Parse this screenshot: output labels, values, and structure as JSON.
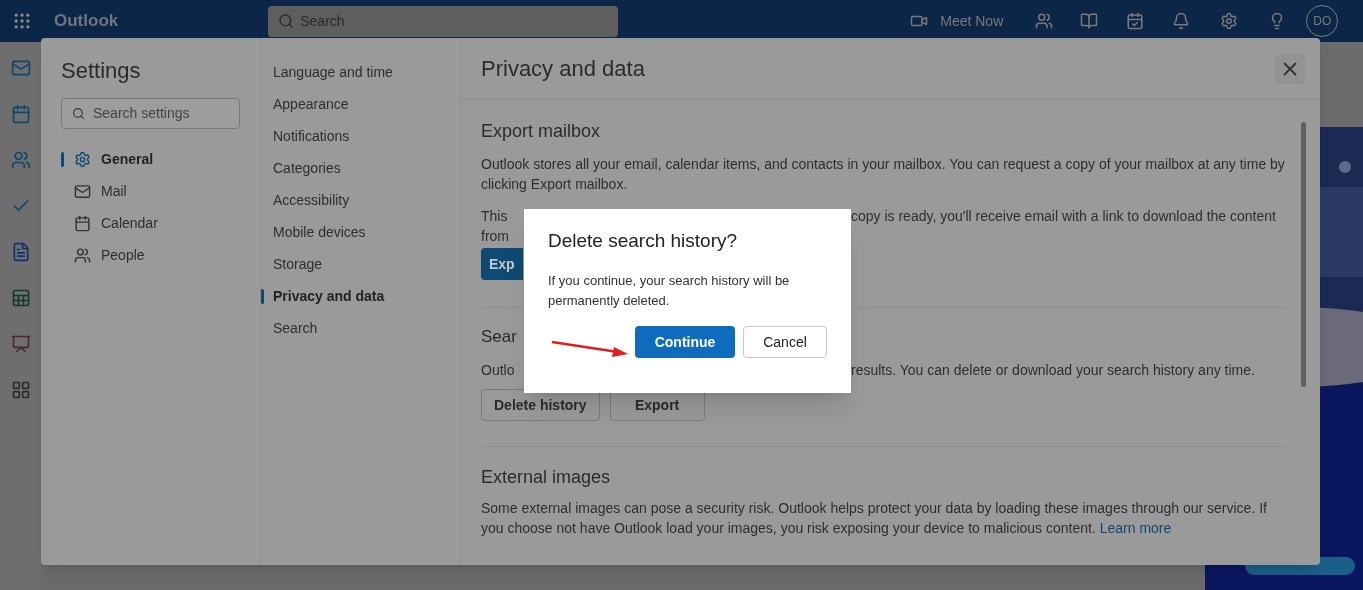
{
  "top_bar": {
    "app_name": "Outlook",
    "search_placeholder": "Search",
    "meet_now": "Meet Now",
    "avatar": "DO"
  },
  "settings": {
    "title": "Settings",
    "search_placeholder": "Search settings",
    "categories": [
      {
        "label": "General",
        "selected": true
      },
      {
        "label": "Mail",
        "selected": false
      },
      {
        "label": "Calendar",
        "selected": false
      },
      {
        "label": "People",
        "selected": false
      }
    ],
    "subsections": [
      {
        "label": "Language and time",
        "selected": false
      },
      {
        "label": "Appearance",
        "selected": false
      },
      {
        "label": "Notifications",
        "selected": false
      },
      {
        "label": "Categories",
        "selected": false
      },
      {
        "label": "Accessibility",
        "selected": false
      },
      {
        "label": "Mobile devices",
        "selected": false
      },
      {
        "label": "Storage",
        "selected": false
      },
      {
        "label": "Privacy and data",
        "selected": true
      },
      {
        "label": "Search",
        "selected": false
      }
    ],
    "page_title": "Privacy and data",
    "export_mailbox": {
      "heading": "Export mailbox",
      "text": "Outlook stores all your email, calendar items, and contacts in your mailbox. You can request a copy of your mailbox at any time by clicking Export mailbox.",
      "line_start": "This",
      "line_end": "copy is ready, you'll receive email with a link to download the content",
      "line_2": "from",
      "button": "Exp"
    },
    "search_history": {
      "heading": "Sear",
      "line_start": "Outlo",
      "line_end": "results. You can delete or download your search history any time.",
      "buttons": [
        "Delete history",
        "Export"
      ]
    },
    "external_images": {
      "heading": "External images",
      "text": "Some external images can pose a security risk. Outlook helps protect your data by loading these images through our service. If you choose not have Outlook load your images, you risk exposing your device to malicious content.",
      "link": "Learn more"
    }
  },
  "dialog": {
    "title": "Delete search history?",
    "text": "If you continue, your search history will be permanently deleted.",
    "buttons": [
      {
        "label": "Continue",
        "primary": true
      },
      {
        "label": "Cancel",
        "primary": false
      }
    ]
  }
}
